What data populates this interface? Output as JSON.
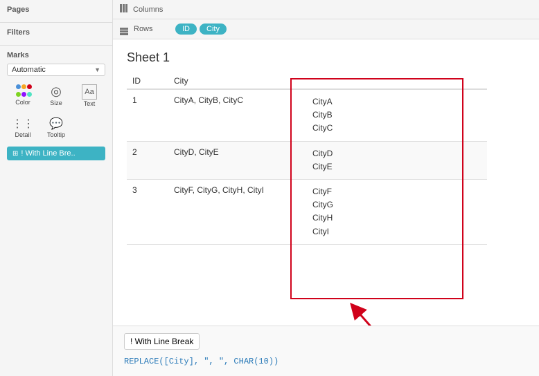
{
  "sidebar": {
    "pages_label": "Pages",
    "filters_label": "Filters",
    "marks_label": "Marks",
    "dropdown_label": "Automatic",
    "color_label": "Color",
    "size_label": "Size",
    "text_label": "Text",
    "detail_label": "Detail",
    "tooltip_label": "Tooltip",
    "with_line_break_label": "! With Line Bre.."
  },
  "header": {
    "columns_label": "Columns",
    "rows_label": "Rows",
    "id_pill": "ID",
    "city_pill": "City"
  },
  "sheet": {
    "title": "Sheet 1",
    "col_id": "ID",
    "col_city": "City",
    "rows": [
      {
        "id": "1",
        "city_text": "CityA, CityB, CityC",
        "city_lines": [
          "CityA",
          "CityB",
          "CityC"
        ]
      },
      {
        "id": "2",
        "city_text": "CityD, CityE",
        "city_lines": [
          "CityD",
          "CityE"
        ]
      },
      {
        "id": "3",
        "city_text": "CityF, CityG, CityH, CityI",
        "city_lines": [
          "CityF",
          "CityG",
          "CityH",
          "CityI"
        ]
      }
    ]
  },
  "formula": {
    "name": "! With Line Break",
    "code": "REPLACE([City], \", \", CHAR(10))"
  }
}
